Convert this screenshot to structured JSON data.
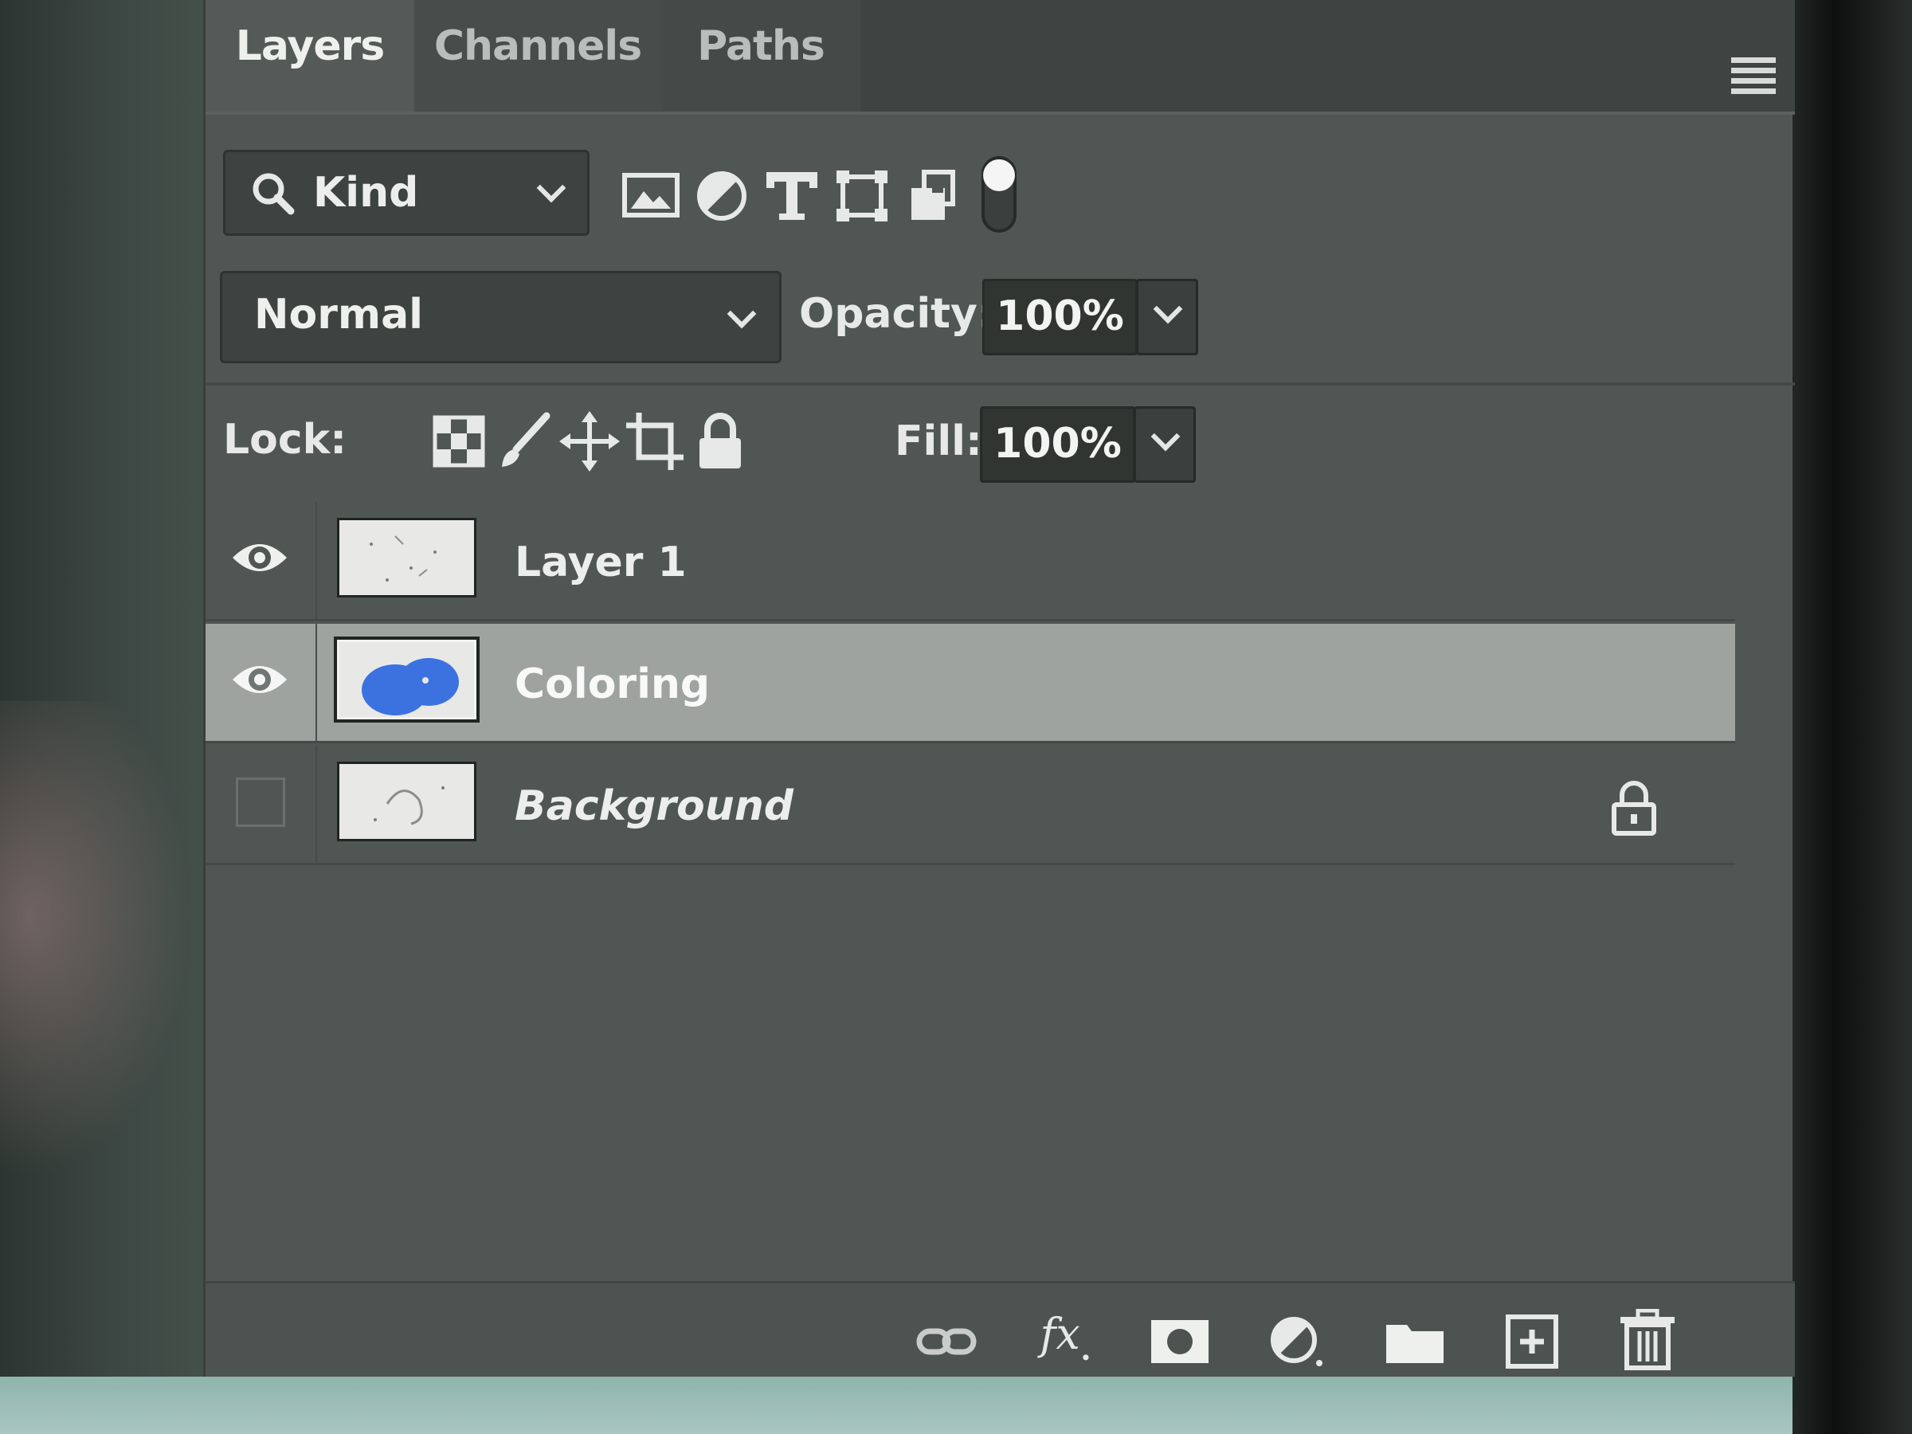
{
  "tabs": [
    {
      "label": "Layers",
      "active": true
    },
    {
      "label": "Channels",
      "active": false
    },
    {
      "label": "Paths",
      "active": false
    }
  ],
  "filter": {
    "kind_label": "Kind",
    "icons": [
      "image-filter-icon",
      "adjustment-filter-icon",
      "type-filter-icon",
      "shape-filter-icon",
      "smart-object-filter-icon",
      "filter-toggle-icon"
    ]
  },
  "blend": {
    "mode": "Normal",
    "opacity_label": "Opacity:",
    "opacity_value": "100%"
  },
  "lock": {
    "label": "Lock:",
    "icons": [
      "lock-transparency-icon",
      "lock-image-pixels-icon",
      "lock-position-icon",
      "lock-artboard-icon",
      "lock-all-icon"
    ],
    "fill_label": "Fill:",
    "fill_value": "100%"
  },
  "layers": [
    {
      "name": "Layer 1",
      "visible": true,
      "selected": false,
      "locked": false
    },
    {
      "name": "Coloring",
      "visible": true,
      "selected": true,
      "locked": false
    },
    {
      "name": "Background",
      "visible": false,
      "selected": false,
      "locked": true
    }
  ],
  "bottom_bar": {
    "icons": [
      "link-layers-icon",
      "fx-icon",
      "layer-mask-icon",
      "adjustment-layer-icon",
      "new-group-icon",
      "new-layer-icon",
      "delete-layer-icon"
    ]
  },
  "colors": {
    "panel_bg": "#505653",
    "selected_row": "#9ea3a0",
    "coloring_blue": "#3b72e0"
  }
}
